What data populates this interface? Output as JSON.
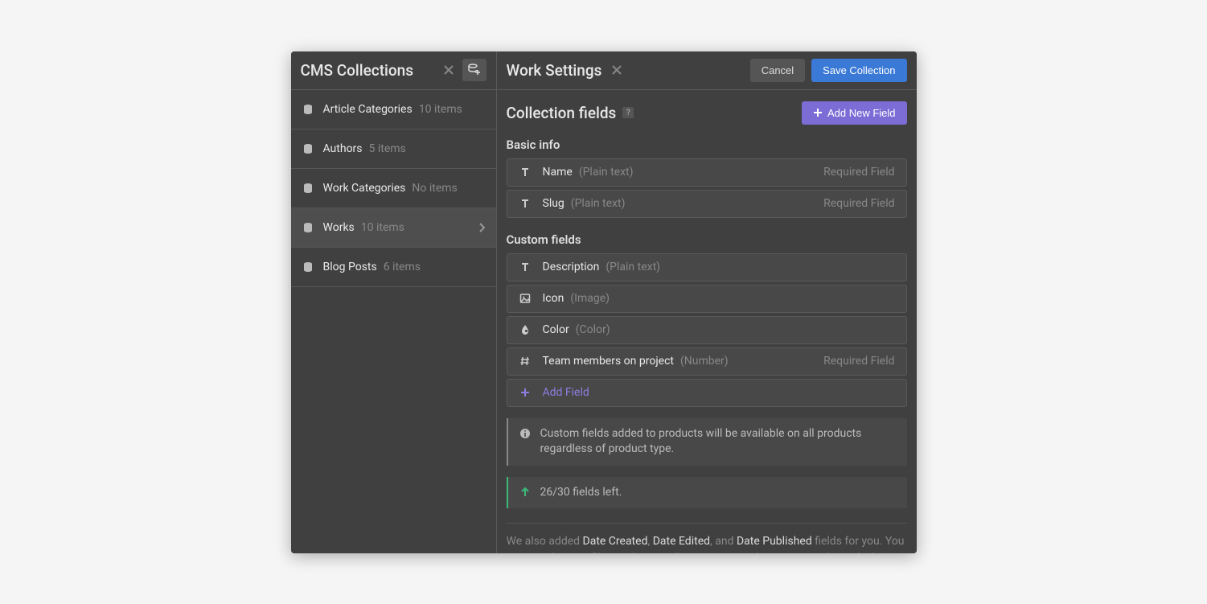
{
  "sidebar": {
    "title": "CMS Collections",
    "items": [
      {
        "name": "Article Categories",
        "count": "10 items"
      },
      {
        "name": "Authors",
        "count": "5 items"
      },
      {
        "name": "Work Categories",
        "count": "No items"
      },
      {
        "name": "Works",
        "count": "10 items"
      },
      {
        "name": "Blog Posts",
        "count": "6 items"
      }
    ]
  },
  "main": {
    "title": "Work Settings",
    "cancel_label": "Cancel",
    "save_label": "Save Collection",
    "section_title": "Collection fields",
    "add_new_field_label": "Add New Field",
    "basic_info_label": "Basic info",
    "basic_fields": [
      {
        "name": "Name",
        "type": "(Plain text)",
        "required": "Required Field",
        "icon": "text"
      },
      {
        "name": "Slug",
        "type": "(Plain text)",
        "required": "Required Field",
        "icon": "text"
      }
    ],
    "custom_fields_label": "Custom fields",
    "custom_fields": [
      {
        "name": "Description",
        "type": "(Plain text)",
        "required": "",
        "icon": "text"
      },
      {
        "name": "Icon",
        "type": "(Image)",
        "required": "",
        "icon": "image"
      },
      {
        "name": "Color",
        "type": "(Color)",
        "required": "",
        "icon": "color"
      },
      {
        "name": "Team members on project",
        "type": "(Number)",
        "required": "Required Field",
        "icon": "hash"
      }
    ],
    "add_field_label": "Add Field",
    "info_text": "Custom fields added to products will be available on all products regardless of product type.",
    "fields_left_text": "26/30 fields left.",
    "footer_prefix": "We also added ",
    "footer_hl1": "Date Created",
    "footer_mid1": ", ",
    "footer_hl2": "Date Edited",
    "footer_mid2": ", and ",
    "footer_hl3": "Date Published",
    "footer_suffix": " fields for you. You can use these to filter and sort Collection Lists in the Designer. These don't count against your field limit."
  }
}
